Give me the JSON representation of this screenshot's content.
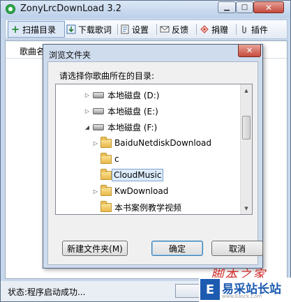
{
  "app": {
    "title": "ZonyLrcDownLoad 3.2",
    "caption_buttons": {
      "minimize": "▁",
      "maximize": "□",
      "close": "✕"
    }
  },
  "toolbar": {
    "items": [
      {
        "label": "扫描目录",
        "icon": "plus-icon"
      },
      {
        "label": "下载歌词",
        "icon": "download-lyrics-icon"
      },
      {
        "label": "设置",
        "icon": "settings-icon"
      },
      {
        "label": "反馈",
        "icon": "mail-icon"
      },
      {
        "label": "捐赠",
        "icon": "donate-icon"
      },
      {
        "label": "插件",
        "icon": "plugin-icon"
      }
    ]
  },
  "list": {
    "column_header": "歌曲名"
  },
  "status": {
    "text": "状态:程序启动成功..."
  },
  "dialog": {
    "title": "浏览文件夹",
    "close": "✕",
    "prompt": "请选择你歌曲所在的目录:",
    "tree": [
      {
        "label": "本地磁盘 (D:)",
        "type": "drive",
        "expanded": false,
        "selected": false
      },
      {
        "label": "本地磁盘 (E:)",
        "type": "drive",
        "expanded": false,
        "selected": false
      },
      {
        "label": "本地磁盘 (F:)",
        "type": "drive",
        "expanded": true,
        "selected": false
      },
      {
        "label": "BaiduNetdiskDownload",
        "type": "folder",
        "expanded": false,
        "selected": false
      },
      {
        "label": "c",
        "type": "folder",
        "expanded": null,
        "selected": false
      },
      {
        "label": "CloudMusic",
        "type": "folder",
        "expanded": null,
        "selected": true
      },
      {
        "label": "KwDownload",
        "type": "folder",
        "expanded": false,
        "selected": false
      },
      {
        "label": "本书案例教学视频",
        "type": "folder",
        "expanded": null,
        "selected": false
      }
    ],
    "buttons": {
      "new_folder": "新建文件夹(M)",
      "ok": "确定",
      "cancel": "取消"
    }
  },
  "watermark": {
    "script": "脚本之家",
    "logo_mark": "E",
    "name": "易采站长站",
    "url": "www.Easck.Com"
  }
}
